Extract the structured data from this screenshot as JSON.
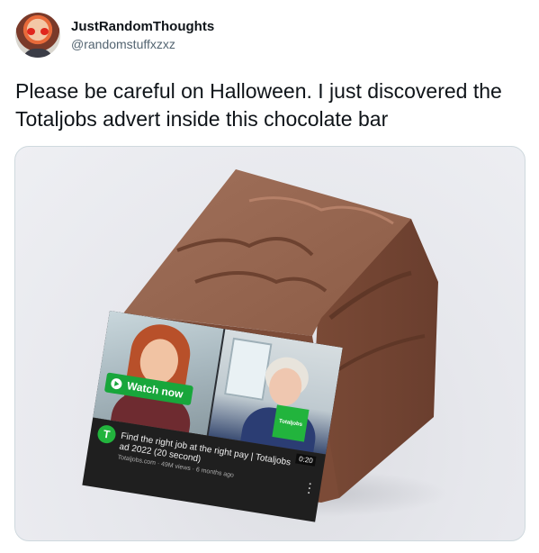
{
  "tweet": {
    "display_name": "JustRandomThoughts",
    "handle": "@randomstuffxzxz",
    "text": "Please be careful on Halloween. I just discovered the Totaljobs advert inside this chocolate bar"
  },
  "ad": {
    "watch_label": "Watch now",
    "brand": "Totaljobs",
    "channel_initial": "T",
    "duration": "0:20",
    "title": "Find the right job at the right pay | Totaljobs ad 2022 (20 second)",
    "meta": "Totaljobs.com · 49M views · 6 months ago"
  },
  "icons": {
    "avatar": "avatar-icon",
    "play": "play-icon",
    "more": "more-vertical-icon"
  },
  "colors": {
    "chocolate": "#8a5a44",
    "brand_green": "#22b43d",
    "watch_green": "#18a63b",
    "text_primary": "#0f1419",
    "text_secondary": "#536471"
  }
}
